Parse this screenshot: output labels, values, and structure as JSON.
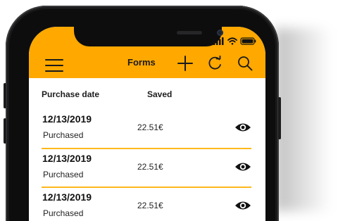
{
  "app": {
    "title": "Forms",
    "accent_color": "#ffa800"
  },
  "header": {
    "menu_icon": "hamburger-menu-icon",
    "add_icon": "plus-icon",
    "refresh_icon": "refresh-icon",
    "search_icon": "search-icon"
  },
  "status_bar": {
    "signal_icon": "cellular-signal-icon",
    "wifi_icon": "wifi-icon",
    "battery_icon": "battery-icon"
  },
  "table": {
    "columns": [
      "Purchase date",
      "Saved"
    ],
    "rows": [
      {
        "date": "12/13/2019",
        "status": "Purchased",
        "amount": "22.51€",
        "action_icon": "eye-icon"
      },
      {
        "date": "12/13/2019",
        "status": "Purchased",
        "amount": "22.51€",
        "action_icon": "eye-icon"
      },
      {
        "date": "12/13/2019",
        "status": "Purchased",
        "amount": "22.51€",
        "action_icon": "eye-icon"
      }
    ]
  }
}
